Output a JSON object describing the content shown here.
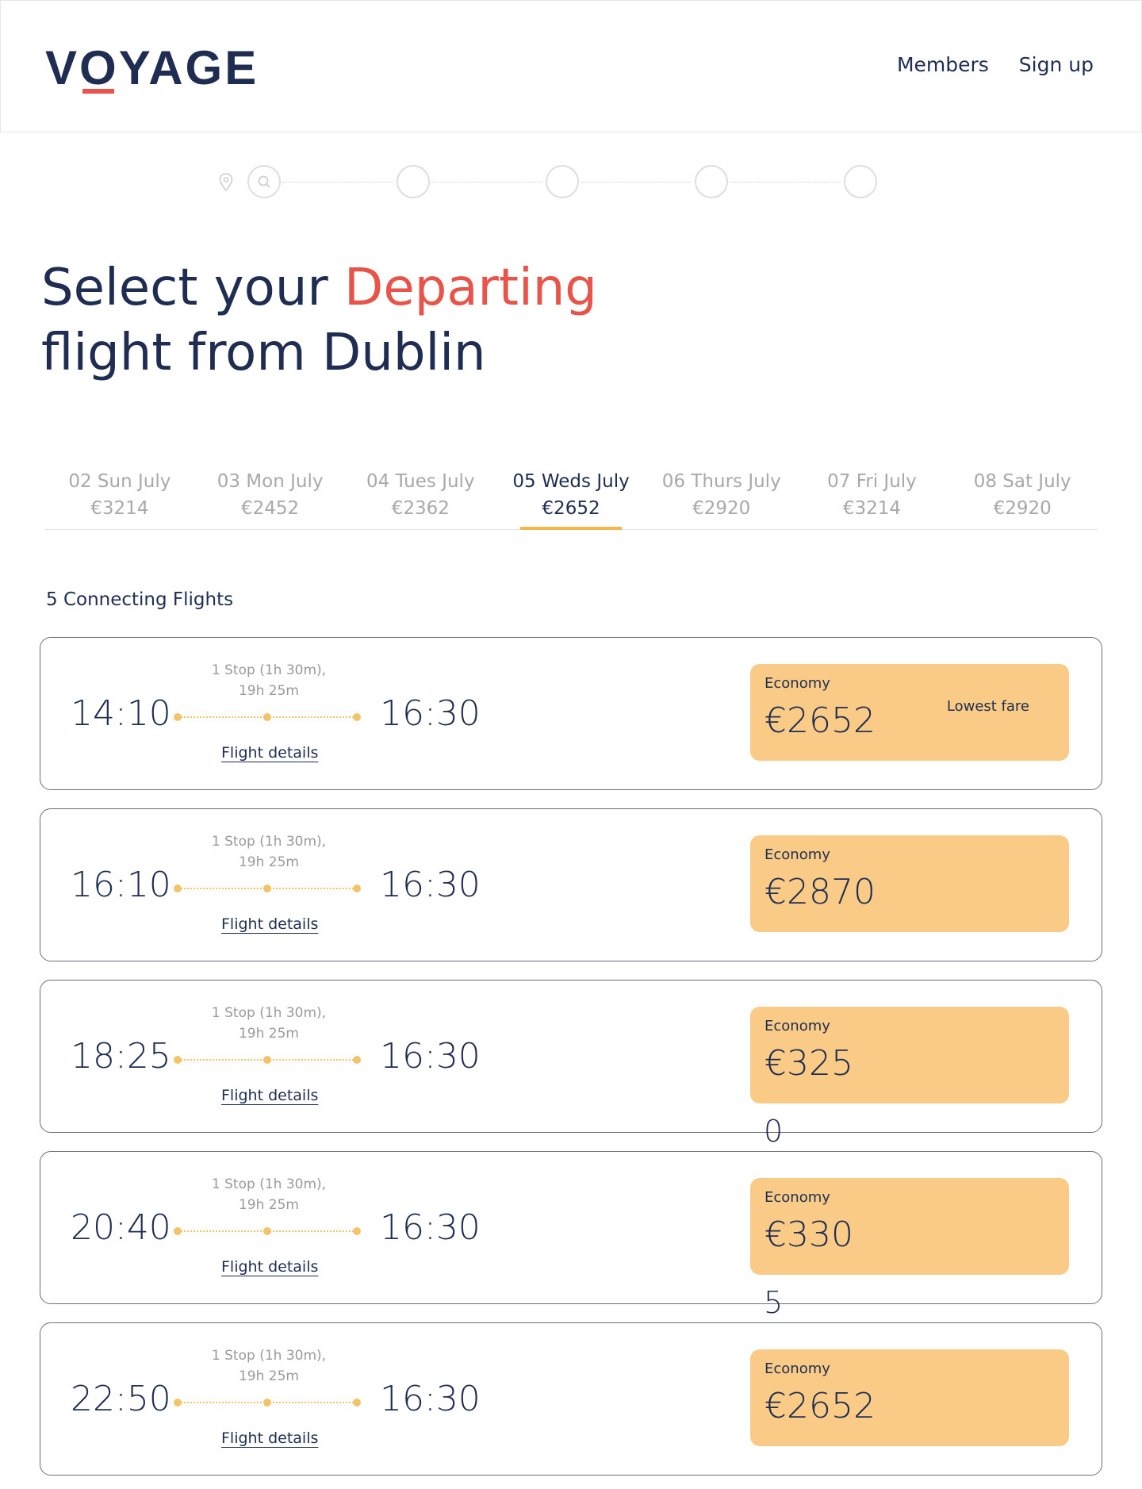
{
  "header": {
    "logo": "VOYAGE",
    "nav": [
      "Members",
      "Sign up"
    ]
  },
  "title": {
    "line1_prefix": "Select your ",
    "line1_accent": "Departing",
    "line2": "flight from Dublin"
  },
  "dates": [
    {
      "day": "02 Sun July",
      "price": "€3214"
    },
    {
      "day": "03 Mon July",
      "price": "€2452"
    },
    {
      "day": "04 Tues July",
      "price": "€2362"
    },
    {
      "day": "05 Weds July",
      "price": "€2652",
      "active": true
    },
    {
      "day": "06 Thurs July",
      "price": "€2920"
    },
    {
      "day": "07 Fri July",
      "price": "€3214"
    },
    {
      "day": "08 Sat July",
      "price": "€2920"
    }
  ],
  "count_label": "5 Connecting Flights",
  "flights": [
    {
      "depart": "14:10",
      "arrive": "16:30",
      "stops": "1 Stop (1h 30m),",
      "duration": "19h 25m",
      "details": "Flight details",
      "fare_class": "Economy",
      "price": "€2652",
      "tag": "Lowest fare"
    },
    {
      "depart": "16:10",
      "arrive": "16:30",
      "stops": "1 Stop (1h 30m),",
      "duration": "19h 25m",
      "details": "Flight details",
      "fare_class": "Economy",
      "price": "€2870",
      "tag": ""
    },
    {
      "depart": "18:25",
      "arrive": "16:30",
      "stops": "1 Stop (1h 30m),",
      "duration": "19h 25m",
      "details": "Flight details",
      "fare_class": "Economy",
      "price": "€325",
      "tag": ""
    },
    {
      "depart": "20:40",
      "arrive": "16:30",
      "stops": "1 Stop (1h 30m),",
      "duration": "19h 25m",
      "details": "Flight details",
      "fare_class": "Economy",
      "price": "€330",
      "tag": ""
    },
    {
      "depart": "22:50",
      "arrive": "16:30",
      "stops": "1 Stop (1h 30m),",
      "duration": "19h 25m",
      "details": "Flight details",
      "fare_class": "Economy",
      "price": "€2652",
      "tag": ""
    }
  ],
  "overflow_digits": [
    "0",
    "5"
  ],
  "colors": {
    "navy": "#1f2d52",
    "accent_red": "#e8534a",
    "fare_yellow": "#f9cb86",
    "route_yellow": "#f2c46a"
  }
}
